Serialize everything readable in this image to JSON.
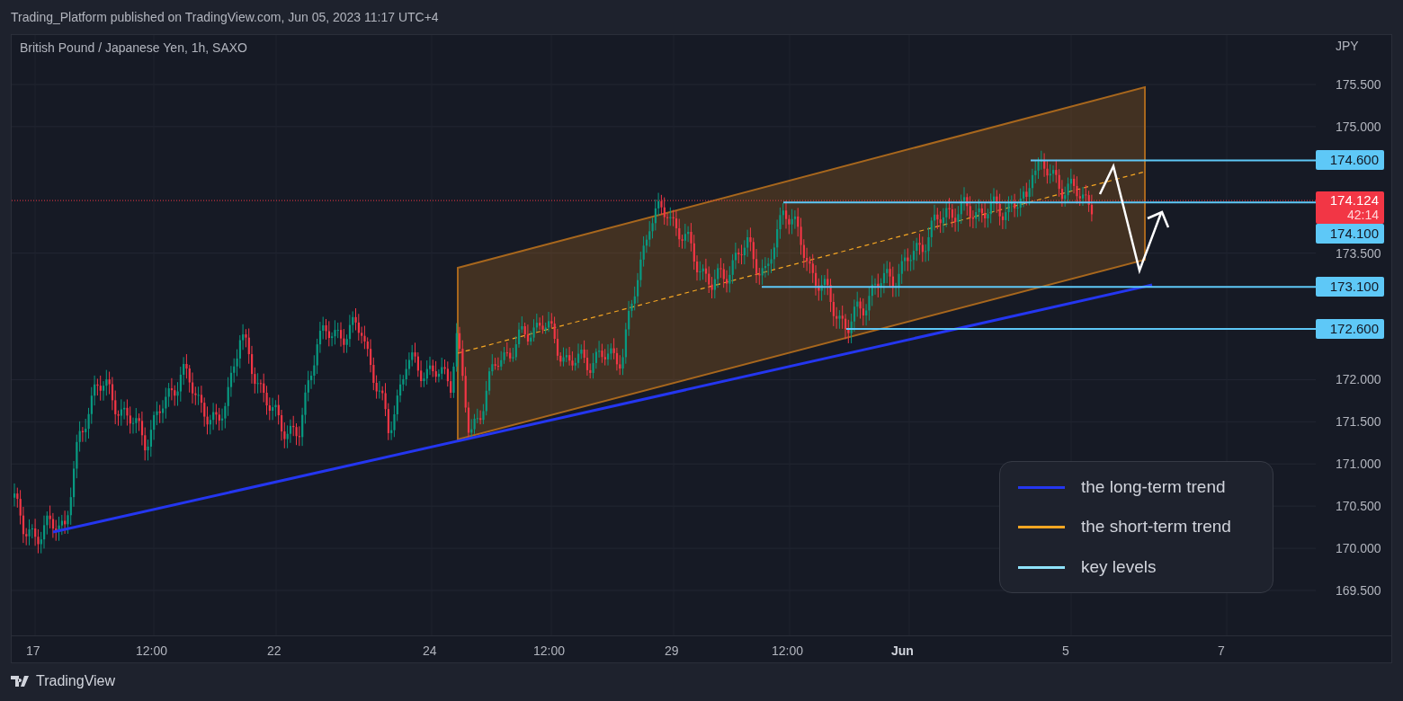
{
  "header": {
    "text": "Trading_Platform published on TradingView.com, Jun 05, 2023 11:17 UTC+4"
  },
  "chart": {
    "symbol_title": "British Pound / Japanese Yen, 1h, SAXO",
    "price_axis": {
      "currency": "JPY",
      "ticks": [
        "175.500",
        "175.000",
        "173.500",
        "172.000",
        "171.500",
        "171.000",
        "170.500",
        "170.000",
        "169.500"
      ]
    },
    "key_levels": [
      {
        "label": "174.600"
      },
      {
        "label": "174.100"
      },
      {
        "label": "173.100"
      },
      {
        "label": "172.600"
      }
    ],
    "current_price": {
      "price": "174.124",
      "countdown": "42:14"
    },
    "time_axis": [
      {
        "label": "17",
        "emphasized": false
      },
      {
        "label": "12:00",
        "emphasized": false
      },
      {
        "label": "22",
        "emphasized": false
      },
      {
        "label": "24",
        "emphasized": false
      },
      {
        "label": "12:00",
        "emphasized": false
      },
      {
        "label": "29",
        "emphasized": false
      },
      {
        "label": "12:00",
        "emphasized": false
      },
      {
        "label": "Jun",
        "emphasized": true
      },
      {
        "label": "5",
        "emphasized": false
      },
      {
        "label": "7",
        "emphasized": false
      }
    ],
    "legend": [
      {
        "label": "the long-term trend",
        "color": "#2436f0"
      },
      {
        "label": "the short-term trend",
        "color": "#f5a623"
      },
      {
        "label": "key levels",
        "color": "#8fe3fb"
      }
    ]
  },
  "footer": {
    "brand": "TradingView"
  }
}
